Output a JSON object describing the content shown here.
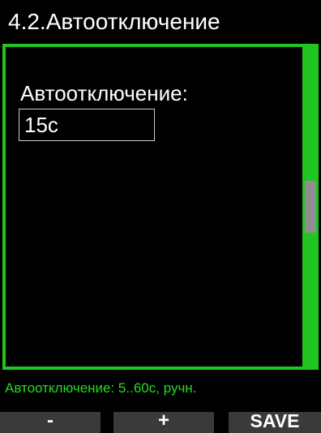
{
  "header": {
    "title": "4.2.Автоотключение"
  },
  "settings_panel": {
    "field_label": "Автоотключение:",
    "field_value": "15с",
    "scrollbar": {
      "position_fraction": 0.5
    }
  },
  "hint": {
    "text": "Автоотключение: 5..60с, ручн."
  },
  "softkeys": {
    "minus_label": "-",
    "plus_label": "+",
    "save_label": "SAVE"
  },
  "colors": {
    "background": "#000000",
    "accent_green": "#22c422",
    "hint_green": "#22dd22",
    "softkey_gray": "#3a3a3a",
    "scroll_thumb": "#8f8f8f"
  }
}
